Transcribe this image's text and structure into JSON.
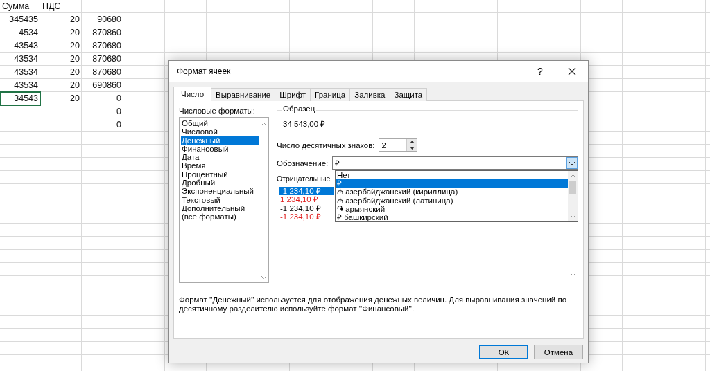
{
  "sheet": {
    "rows": [
      {
        "kind": "header",
        "cells": [
          {
            "text": "Сумма",
            "selected": false
          },
          {
            "text": "НДС",
            "selected": false
          },
          {
            "selected": false
          }
        ]
      },
      {
        "kind": "number",
        "cells": [
          {
            "text": "345435",
            "selected": false
          },
          {
            "text": "20",
            "selected": false
          },
          {
            "text": "90680",
            "selected": false
          }
        ]
      },
      {
        "kind": "number",
        "cells": [
          {
            "text": "4534",
            "selected": false
          },
          {
            "text": "20",
            "selected": false
          },
          {
            "text": "870860",
            "selected": false
          }
        ]
      },
      {
        "kind": "number",
        "cells": [
          {
            "text": "43543",
            "selected": false
          },
          {
            "text": "20",
            "selected": false
          },
          {
            "text": "870680",
            "selected": false
          }
        ]
      },
      {
        "kind": "number",
        "cells": [
          {
            "text": "43534",
            "selected": false
          },
          {
            "text": "20",
            "selected": false
          },
          {
            "text": "870680",
            "selected": false
          }
        ]
      },
      {
        "kind": "number",
        "cells": [
          {
            "text": "43534",
            "selected": false
          },
          {
            "text": "20",
            "selected": false
          },
          {
            "text": "870680",
            "selected": false
          }
        ]
      },
      {
        "kind": "number",
        "cells": [
          {
            "text": "43534",
            "selected": false
          },
          {
            "text": "20",
            "selected": false
          },
          {
            "text": "690860",
            "selected": false
          }
        ]
      },
      {
        "kind": "number",
        "cells": [
          {
            "text": "34543",
            "selected": true
          },
          {
            "text": "20",
            "selected": false
          },
          {
            "text": "0",
            "selected": false
          }
        ]
      },
      {
        "kind": "number",
        "cells": [
          {
            "selected": false
          },
          {
            "selected": false
          },
          {
            "text": "0",
            "selected": false
          }
        ]
      },
      {
        "kind": "number",
        "cells": [
          {
            "selected": false
          },
          {
            "selected": false
          },
          {
            "text": "0",
            "selected": false
          }
        ]
      }
    ]
  },
  "dialog": {
    "title": "Формат ячеек",
    "help": "?",
    "tabs": [
      {
        "label": "Число",
        "selected": true
      },
      {
        "label": "Выравнивание",
        "selected": false
      },
      {
        "label": "Шрифт",
        "selected": false
      },
      {
        "label": "Граница",
        "selected": false
      },
      {
        "label": "Заливка",
        "selected": false
      },
      {
        "label": "Защита",
        "selected": false
      }
    ],
    "formats_label": "Числовые форматы:",
    "formats": [
      {
        "label": "Общий",
        "selected": false
      },
      {
        "label": "Числовой",
        "selected": false
      },
      {
        "label": "Денежный",
        "selected": true
      },
      {
        "label": "Финансовый",
        "selected": false
      },
      {
        "label": "Дата",
        "selected": false
      },
      {
        "label": "Время",
        "selected": false
      },
      {
        "label": "Процентный",
        "selected": false
      },
      {
        "label": "Дробный",
        "selected": false
      },
      {
        "label": "Экспоненциальный",
        "selected": false
      },
      {
        "label": "Текстовый",
        "selected": false
      },
      {
        "label": "Дополнительный",
        "selected": false
      },
      {
        "label": "(все форматы)",
        "selected": false
      }
    ],
    "sample_label": "Образец",
    "sample_value": "34 543,00 ₽",
    "decimals_label": "Число десятичных знаков:",
    "decimals_value": "2",
    "symbol_label": "Обозначение:",
    "symbol_value": "₽",
    "symbol_options": [
      {
        "label": "Нет",
        "selected": false
      },
      {
        "label": "₽",
        "selected": true
      },
      {
        "label": "₼ азербайджанский (кириллица)",
        "selected": false
      },
      {
        "label": "₼ азербайджанский (латиница)",
        "selected": false
      },
      {
        "label": "֏ армянский",
        "selected": false
      },
      {
        "label": "₽ башкирский",
        "selected": false
      }
    ],
    "negative_label": "Отрицательные",
    "negative_formats": [
      {
        "label": "-1 234,10 ₽",
        "selected": true
      },
      {
        "label": "1 234,10 ₽",
        "color": "#e02020",
        "selected": false
      },
      {
        "label": "-1 234,10 ₽",
        "color": "#000000",
        "selected": false
      },
      {
        "label": "-1 234,10 ₽",
        "color": "#e02020",
        "selected": false
      }
    ],
    "description": "Формат ''Денежный'' используется для отображения денежных величин. Для выравнивания значений по десятичному разделителю используйте формат ''Финансовый''.",
    "buttons": [
      {
        "label": "ОК",
        "default": true
      },
      {
        "label": "Отмена",
        "default": false
      }
    ]
  }
}
